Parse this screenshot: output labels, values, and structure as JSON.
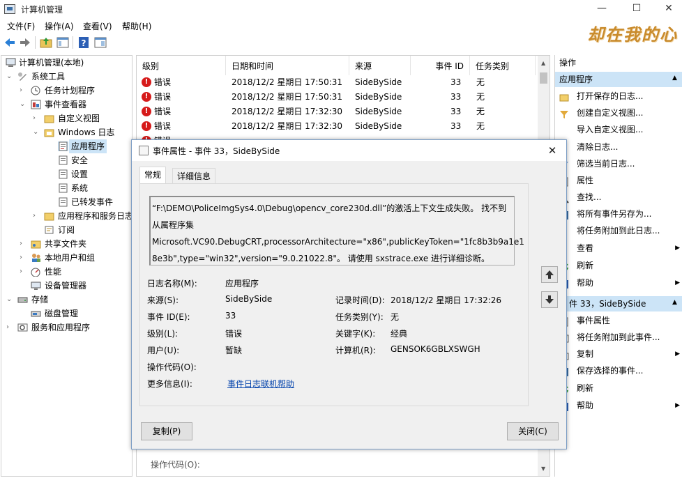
{
  "window": {
    "title": "计算机管理",
    "brand_text": "却在我的心"
  },
  "menu": [
    "文件(F)",
    "操作(A)",
    "查看(V)",
    "帮助(H)"
  ],
  "tree": [
    {
      "label": "计算机管理(本地)",
      "icon": "computer-management-icon"
    },
    {
      "label": "系统工具",
      "icon": "tools-icon"
    },
    {
      "label": "任务计划程序",
      "icon": "clock-icon"
    },
    {
      "label": "事件查看器",
      "icon": "event-viewer-icon"
    },
    {
      "label": "自定义视图",
      "icon": "folder-icon"
    },
    {
      "label": "Windows 日志",
      "icon": "folder-icon"
    },
    {
      "label": "应用程序",
      "icon": "log-icon"
    },
    {
      "label": "安全",
      "icon": "log-icon"
    },
    {
      "label": "设置",
      "icon": "log-icon"
    },
    {
      "label": "系统",
      "icon": "log-icon"
    },
    {
      "label": "已转发事件",
      "icon": "log-icon"
    },
    {
      "label": "应用程序和服务日志",
      "icon": "folder-icon"
    },
    {
      "label": "订阅",
      "icon": "subscription-icon"
    },
    {
      "label": "共享文件夹",
      "icon": "shared-folder-icon"
    },
    {
      "label": "本地用户和组",
      "icon": "users-icon"
    },
    {
      "label": "性能",
      "icon": "performance-icon"
    },
    {
      "label": "设备管理器",
      "icon": "device-manager-icon"
    },
    {
      "label": "存储",
      "icon": "storage-icon"
    },
    {
      "label": "磁盘管理",
      "icon": "disk-icon"
    },
    {
      "label": "服务和应用程序",
      "icon": "services-icon"
    }
  ],
  "events": {
    "columns": [
      "级别",
      "日期和时间",
      "来源",
      "事件 ID",
      "任务类别"
    ],
    "rows": [
      {
        "level": "错误",
        "datetime": "2018/12/2 星期日 17:50:31",
        "source": "SideBySide",
        "id": "33",
        "category": "无"
      },
      {
        "level": "错误",
        "datetime": "2018/12/2 星期日 17:50:31",
        "source": "SideBySide",
        "id": "33",
        "category": "无"
      },
      {
        "level": "错误",
        "datetime": "2018/12/2 星期日 17:32:30",
        "source": "SideBySide",
        "id": "33",
        "category": "无"
      },
      {
        "level": "错误",
        "datetime": "2018/12/2 星期日 17:32:30",
        "source": "SideBySide",
        "id": "33",
        "category": "无"
      }
    ],
    "partial_row_level": "错误",
    "footer_label": "操作代码(O):"
  },
  "actions": {
    "header": "操作",
    "section1": "应用程序",
    "items1": [
      {
        "label": "打开保存的日志...",
        "icon": "open-log-icon"
      },
      {
        "label": "创建自定义视图...",
        "icon": "filter-icon"
      },
      {
        "label": "导入自定义视图...",
        "icon": "import-icon"
      },
      {
        "label": "清除日志...",
        "icon": "clear-icon"
      },
      {
        "label": "筛选当前日志...",
        "icon": "filter-icon"
      },
      {
        "label": "属性",
        "icon": "properties-icon"
      },
      {
        "label": "查找...",
        "icon": "find-icon"
      },
      {
        "label": "将所有事件另存为...",
        "icon": "save-icon"
      },
      {
        "label": "将任务附加到此日志...",
        "icon": "task-icon"
      },
      {
        "label": "查看",
        "icon": "view-icon",
        "submenu": true
      },
      {
        "label": "刷新",
        "icon": "refresh-icon"
      },
      {
        "label": "帮助",
        "icon": "help-icon",
        "submenu": true
      }
    ],
    "section2": "件 33，SideBySide",
    "items2": [
      {
        "label": "事件属性",
        "icon": "properties-icon"
      },
      {
        "label": "将任务附加到此事件...",
        "icon": "task-icon"
      },
      {
        "label": "复制",
        "icon": "copy-icon",
        "submenu": true
      },
      {
        "label": "保存选择的事件...",
        "icon": "save-icon"
      },
      {
        "label": "刷新",
        "icon": "refresh-icon"
      },
      {
        "label": "帮助",
        "icon": "help-icon",
        "submenu": true
      }
    ]
  },
  "dialog": {
    "title": "事件属性 - 事件 33，SideBySide",
    "tabs": [
      "常规",
      "详细信息"
    ],
    "description": [
      "“F:\\DEMO\\PoliceImgSys4.0\\Debug\\opencv_core230d.dll”的激活上下文生成失败。 找不到",
      "从属程序集",
      "Microsoft.VC90.DebugCRT,processorArchitecture=\"x86\",publicKeyToken=\"1fc8b3b9a1e1",
      "8e3b\",type=\"win32\",version=\"9.0.21022.8\"。 请使用 sxstrace.exe 进行详细诊断。"
    ],
    "fields": {
      "log_name_label": "日志名称(M):",
      "log_name": "应用程序",
      "source_label": "来源(S):",
      "source": "SideBySide",
      "recorded_label": "记录时间(D):",
      "recorded": "2018/12/2 星期日 17:32:26",
      "event_id_label": "事件 ID(E):",
      "event_id": "33",
      "task_category_label": "任务类别(Y):",
      "task_category": "无",
      "level_label": "级别(L):",
      "level": "错误",
      "keywords_label": "关键字(K):",
      "keywords": "经典",
      "user_label": "用户(U):",
      "user": "暂缺",
      "computer_label": "计算机(R):",
      "computer": "GENSOK6GBLXSWGH",
      "opcode_label": "操作代码(O):",
      "more_info_label": "更多信息(I):",
      "more_info_link": "事件日志联机帮助"
    },
    "copy_button": "复制(P)",
    "close_button": "关闭(C)"
  }
}
